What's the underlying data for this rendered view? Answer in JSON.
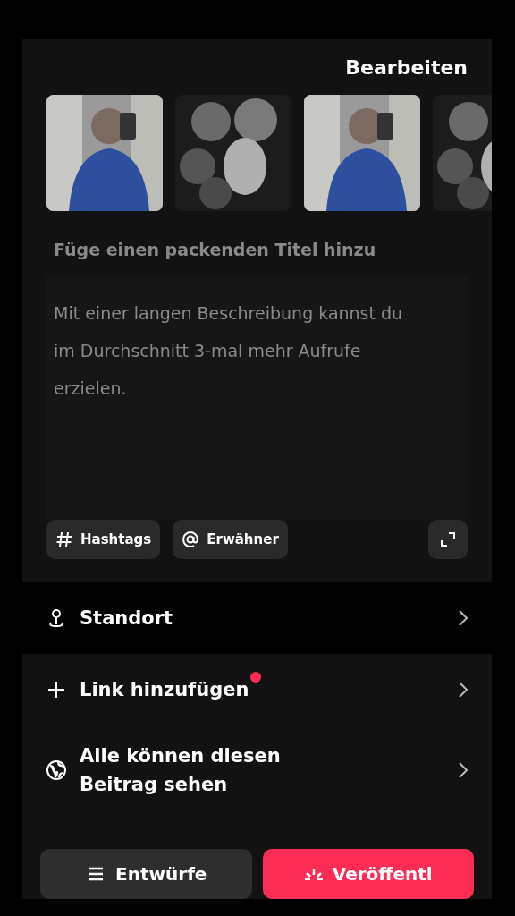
{
  "header": {
    "edit_button": "Bearbeiten"
  },
  "title_field": {
    "placeholder": "Füge einen packenden Titel hinzu"
  },
  "description_field": {
    "placeholder": "Mit einer langen Beschreibung kannst du im Durchschnitt 3-mal mehr Aufrufe erzielen."
  },
  "chips": [
    {
      "kind": "hashtag",
      "label": "Hashtags"
    },
    {
      "kind": "mention",
      "label": "Erwähner"
    }
  ],
  "location": {
    "label": "Standort"
  },
  "settings": [
    {
      "kind": "link",
      "label": "Link hinzufügen",
      "badge": true
    },
    {
      "kind": "privacy",
      "label": "Alle können diesen Beitrag sehen",
      "badge": false
    }
  ],
  "actions": [
    {
      "kind": "drafts",
      "label": "Entwürfe"
    },
    {
      "kind": "publish",
      "label": "Veröffentl"
    }
  ]
}
